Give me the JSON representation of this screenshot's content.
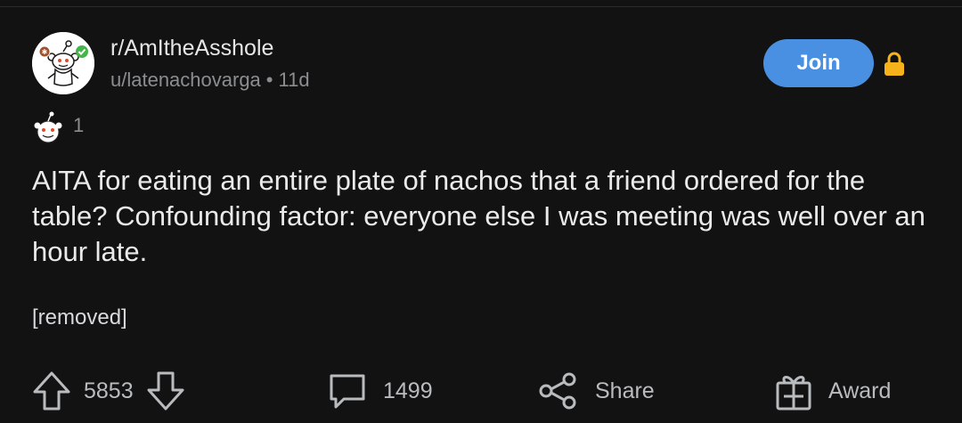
{
  "post": {
    "subreddit": "r/AmItheAsshole",
    "author": "u/latenachovarga",
    "separator": "•",
    "age": "11d",
    "join_label": "Join",
    "flair_count": "1",
    "title": "AITA for eating an entire plate of nachos that a friend ordered for the table? Confounding factor: everyone else I was meeting was well over an hour late.",
    "body": "[removed]"
  },
  "actions": {
    "votes": "5853",
    "comments": "1499",
    "share_label": "Share",
    "award_label": "Award"
  },
  "icons": {
    "avatar": "snoo-avatar-icon",
    "lock": "lock-icon",
    "flair": "snoo-flair-icon",
    "upvote": "upvote-arrow-icon",
    "downvote": "downvote-arrow-icon",
    "comment": "comment-bubble-icon",
    "share": "share-icon",
    "award": "gift-award-icon"
  },
  "colors": {
    "background": "#121212",
    "join_button": "#4a90e2",
    "lock": "#f5b21b",
    "verified_badge": "#46b34b"
  }
}
